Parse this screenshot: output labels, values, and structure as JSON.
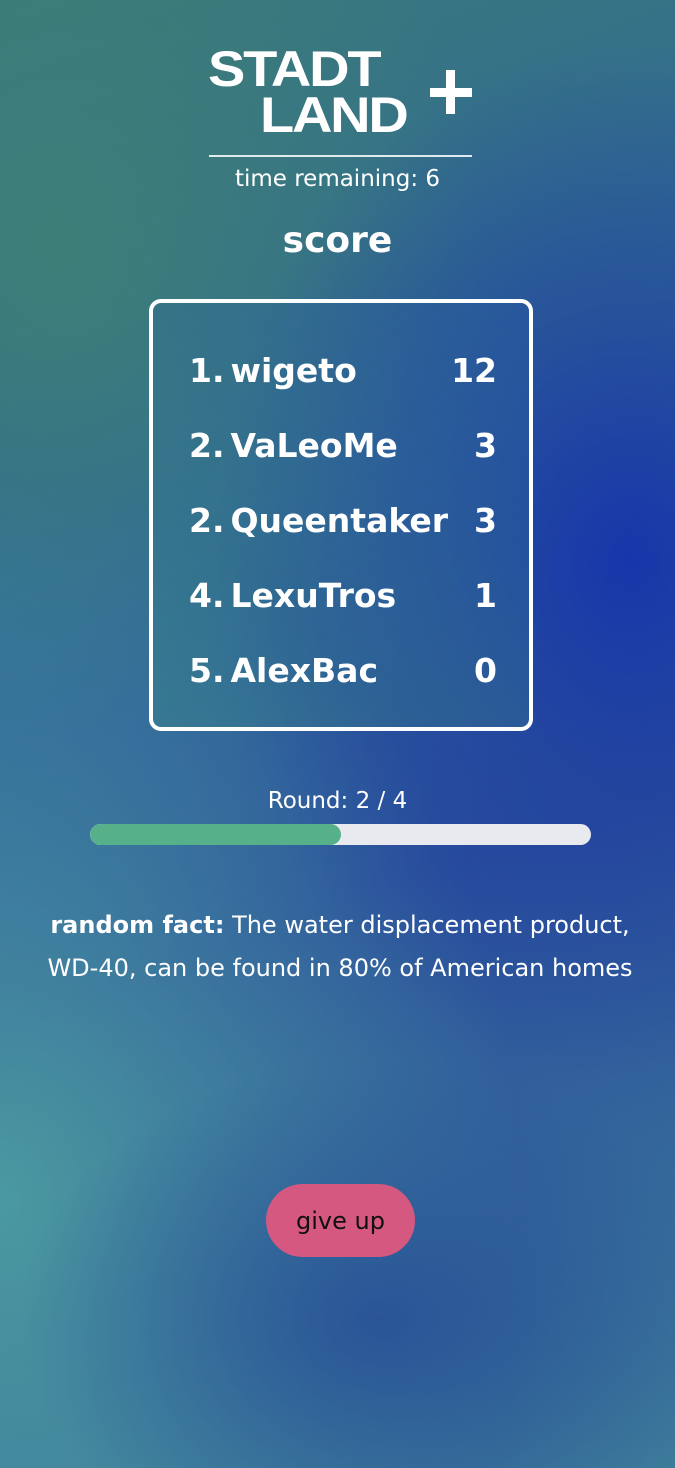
{
  "logo": {
    "line1": "STADT",
    "line2": "LAND",
    "plus": "+"
  },
  "timer": {
    "label": "time remaining:",
    "value": "6"
  },
  "score": {
    "title": "score",
    "rows": [
      {
        "rank": "1.",
        "name": "wigeto",
        "points": "12"
      },
      {
        "rank": "2.",
        "name": "VaLeoMe",
        "points": "3"
      },
      {
        "rank": "2.",
        "name": "Queentaker",
        "points": "3"
      },
      {
        "rank": "4.",
        "name": "LexuTros",
        "points": "1"
      },
      {
        "rank": "5.",
        "name": "AlexBac",
        "points": "0"
      }
    ]
  },
  "round": {
    "label": "Round: 2 / 4",
    "current": 2,
    "total": 4,
    "fill_color": "#56b08a",
    "track_color": "#e9eaf0"
  },
  "fact": {
    "label": "random fact:",
    "text": "The water displacement product, WD-40, can be found in 80% of American homes"
  },
  "actions": {
    "give_up_label": "give up",
    "give_up_color": "#d4587f"
  }
}
